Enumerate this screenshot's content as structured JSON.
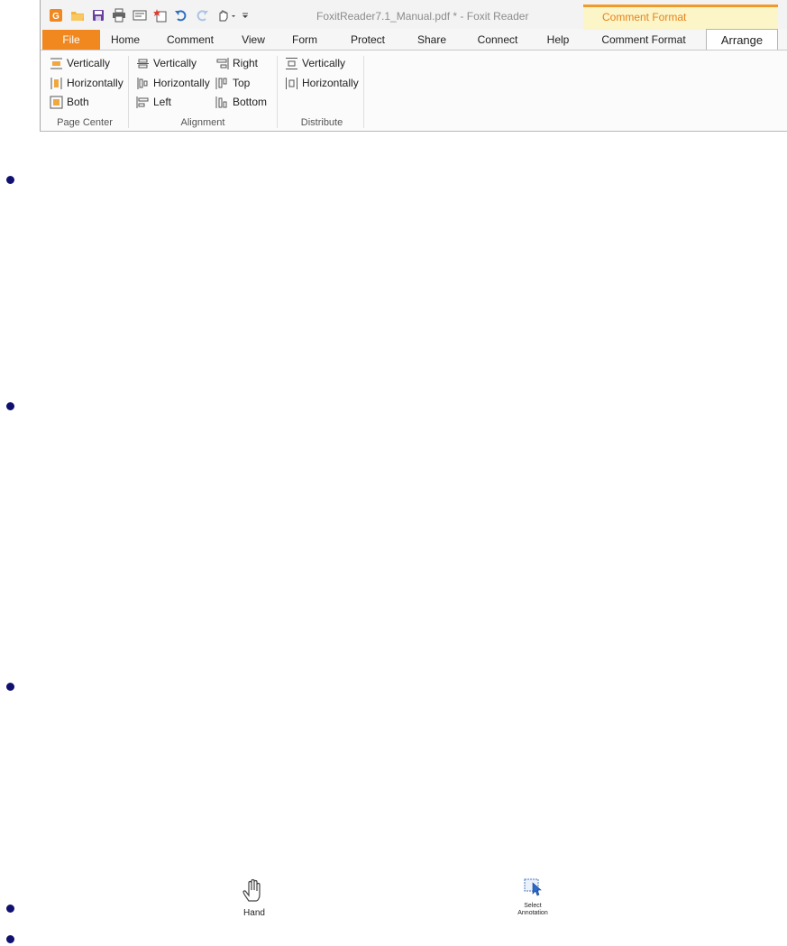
{
  "window": {
    "title": "FoxitReader7.1_Manual.pdf * - Foxit Reader",
    "contextual_group": "Comment Format"
  },
  "quick_access": {
    "icons": [
      "foxit-logo-icon",
      "open-folder-icon",
      "save-icon",
      "print-icon",
      "properties-icon",
      "new-icon",
      "undo-icon",
      "redo-icon",
      "hand-tool-icon",
      "customize-icon"
    ]
  },
  "tabs": [
    {
      "label": "File"
    },
    {
      "label": "Home"
    },
    {
      "label": "Comment"
    },
    {
      "label": "View"
    },
    {
      "label": "Form"
    },
    {
      "label": "Protect"
    },
    {
      "label": "Share"
    },
    {
      "label": "Connect"
    },
    {
      "label": "Help"
    },
    {
      "label": "Comment Format"
    },
    {
      "label": "Arrange"
    }
  ],
  "ribbon": {
    "page_center": {
      "label": "Page Center",
      "vertically": "Vertically",
      "horizontally": "Horizontally",
      "both": "Both"
    },
    "alignment": {
      "label": "Alignment",
      "vertically": "Vertically",
      "horizontally": "Horizontally",
      "left": "Left",
      "right": "Right",
      "top": "Top",
      "bottom": "Bottom"
    },
    "distribute": {
      "label": "Distribute",
      "vertically": "Vertically",
      "horizontally": "Horizontally"
    }
  },
  "tools": {
    "hand": "Hand",
    "select_annotation_line1": "Select",
    "select_annotation_line2": "Annotation"
  },
  "colors": {
    "accent_orange": "#f0881f",
    "context_band": "#fbf5c7",
    "bullet": "#101070"
  }
}
